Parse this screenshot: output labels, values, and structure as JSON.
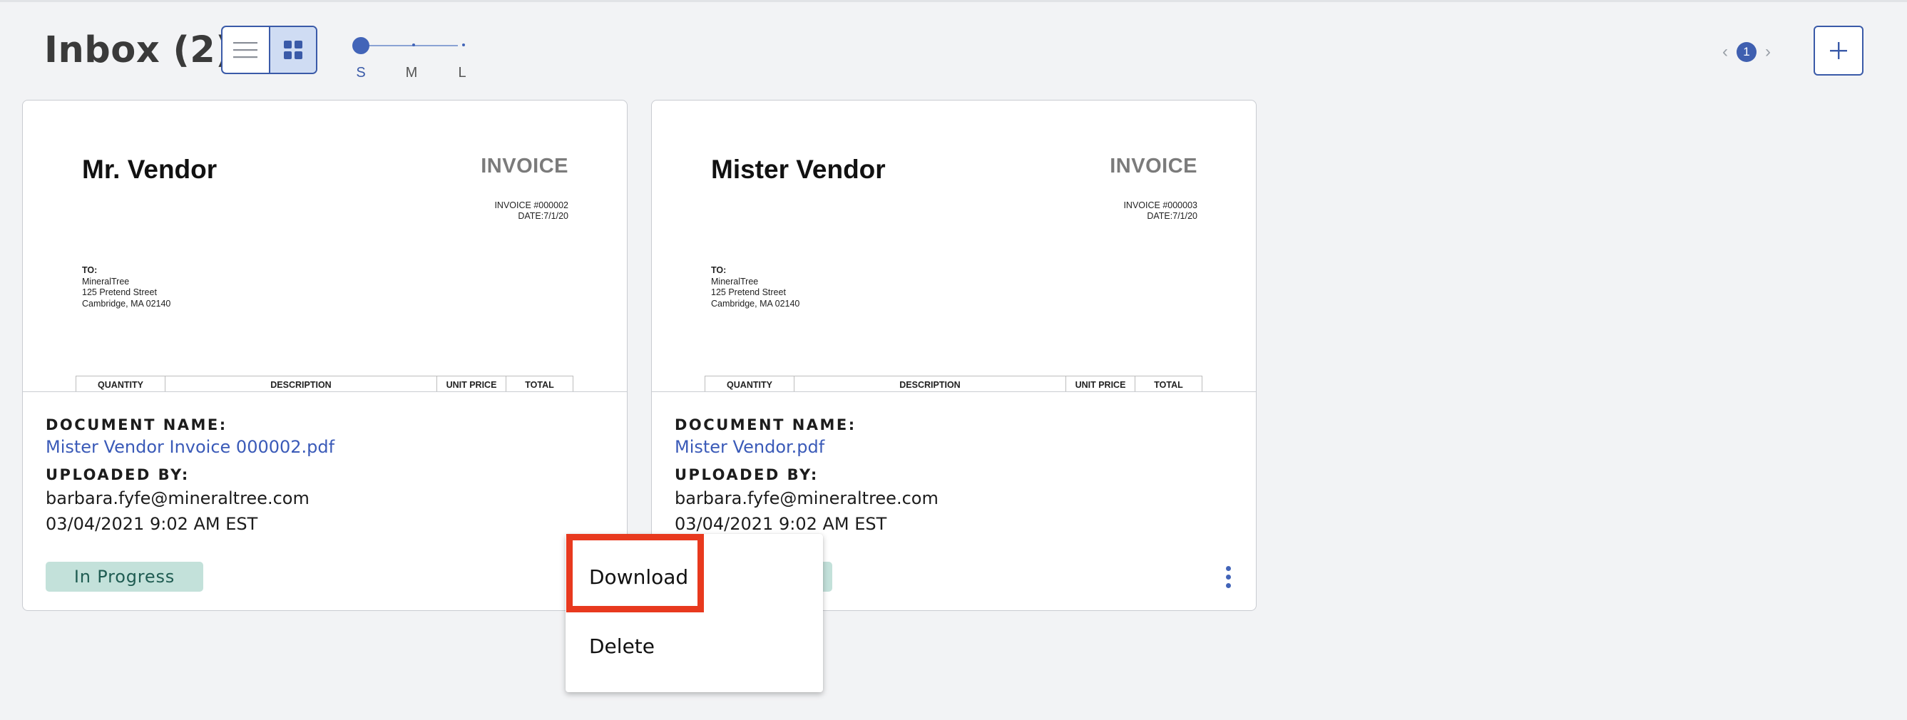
{
  "header": {
    "title": "Inbox (2)",
    "view_modes": [
      "list-icon",
      "grid-icon"
    ],
    "active_view": "grid",
    "size_labels": [
      "S",
      "M",
      "L"
    ],
    "selected_size": "S",
    "pagination": {
      "prev": "‹",
      "page": "1",
      "next": "›"
    },
    "add_label": "+"
  },
  "cards": [
    {
      "preview": {
        "vendor": "Mr. Vendor",
        "heading": "INVOICE",
        "invoice_no": "INVOICE #000002",
        "date": "DATE:7/1/20",
        "to_label": "TO:",
        "to_lines": [
          "MineralTree",
          "125 Pretend Street",
          "Cambridge, MA 02140"
        ],
        "table_headers": [
          "QUANTITY",
          "DESCRIPTION",
          "UNIT PRICE",
          "TOTAL"
        ]
      },
      "doc_label": "DOCUMENT NAME:",
      "doc_name": "Mister Vendor Invoice 000002.pdf",
      "uploaded_label": "UPLOADED BY:",
      "uploader": "barbara.fyfe@mineraltree.com",
      "uploaded_at": "03/04/2021 9:02 AM EST",
      "status": "In Progress"
    },
    {
      "preview": {
        "vendor": "Mister Vendor",
        "heading": "INVOICE",
        "invoice_no": "INVOICE #000003",
        "date": "DATE:7/1/20",
        "to_label": "TO:",
        "to_lines": [
          "MineralTree",
          "125 Pretend Street",
          "Cambridge, MA 02140"
        ],
        "table_headers": [
          "QUANTITY",
          "DESCRIPTION",
          "UNIT PRICE",
          "TOTAL"
        ]
      },
      "doc_label": "DOCUMENT NAME:",
      "doc_name": "Mister Vendor.pdf",
      "uploaded_label": "UPLOADED BY:",
      "uploader": "barbara.fyfe@mineraltree.com",
      "uploaded_at": "03/04/2021 9:02 AM EST",
      "status": ""
    }
  ],
  "context_menu": {
    "items": [
      "Download",
      "Delete"
    ],
    "highlighted": "Download"
  },
  "colors": {
    "accent": "#3a5aa8",
    "status_bg": "#c3e1da",
    "highlight": "#e8391e"
  }
}
